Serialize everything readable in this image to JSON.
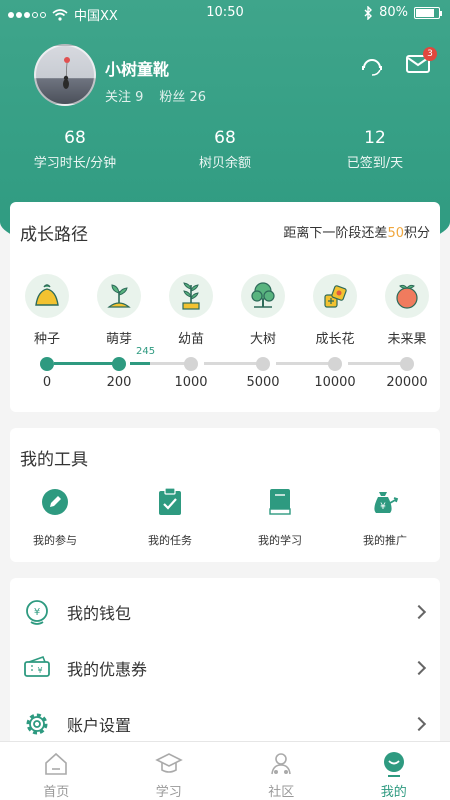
{
  "status_bar": {
    "carrier": "中国XX",
    "time": "10:50",
    "battery": "80%"
  },
  "profile": {
    "name": "小树童靴",
    "following_label": "关注 9",
    "followers_label": "粉丝 26",
    "message_badge": "3"
  },
  "stats": [
    {
      "value": "68",
      "label": "学习时长/分钟"
    },
    {
      "value": "68",
      "label": "树贝余额"
    },
    {
      "value": "12",
      "label": "已签到/天"
    }
  ],
  "growth": {
    "title": "成长路径",
    "hint_prefix": "距离下一阶段还差",
    "hint_points": "50",
    "hint_suffix": "积分",
    "current_value": "245",
    "stages": [
      {
        "name": "种子",
        "icon": "seed-icon",
        "threshold": "0"
      },
      {
        "name": "萌芽",
        "icon": "sprout-icon",
        "threshold": "200"
      },
      {
        "name": "幼苗",
        "icon": "seedling-icon",
        "threshold": "1000"
      },
      {
        "name": "大树",
        "icon": "tree-icon",
        "threshold": "5000"
      },
      {
        "name": "成长花",
        "icon": "flower-icon",
        "threshold": "10000"
      },
      {
        "name": "未来果",
        "icon": "fruit-icon",
        "threshold": "20000"
      }
    ]
  },
  "tools": {
    "title": "我的工具",
    "items": [
      {
        "label": "我的参与",
        "icon": "pencil-icon"
      },
      {
        "label": "我的任务",
        "icon": "clipboard-check-icon"
      },
      {
        "label": "我的学习",
        "icon": "book-icon"
      },
      {
        "label": "我的推广",
        "icon": "money-bag-icon"
      }
    ]
  },
  "menu": [
    {
      "label": "我的钱包",
      "icon": "wallet-icon"
    },
    {
      "label": "我的优惠券",
      "icon": "coupon-icon"
    },
    {
      "label": "账户设置",
      "icon": "gear-icon"
    }
  ],
  "tabbar": [
    {
      "label": "首页",
      "icon": "home-icon"
    },
    {
      "label": "学习",
      "icon": "graduation-cap-icon"
    },
    {
      "label": "社区",
      "icon": "community-icon"
    },
    {
      "label": "我的",
      "icon": "profile-icon"
    }
  ],
  "colors": {
    "primary": "#2e9a80",
    "highlight": "#f0a73d",
    "badge": "#e0483e"
  }
}
